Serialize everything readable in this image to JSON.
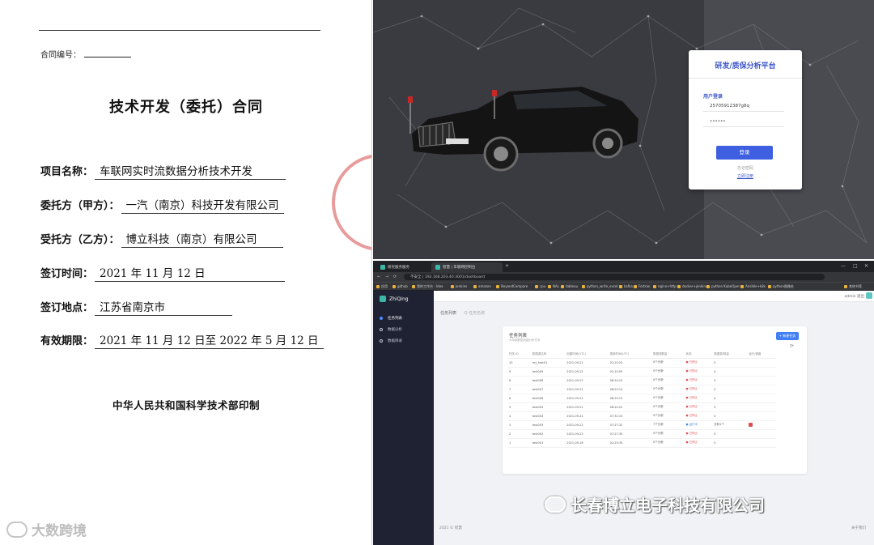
{
  "contract": {
    "contract_no_label": "合同编号：",
    "title": "技术开发（委托）合同",
    "fields": [
      {
        "label": "项目名称：",
        "value": "车联网实时流数据分析技术开发"
      },
      {
        "label": "委托方（甲方）：",
        "value": "一汽（南京）科技开发有限公司"
      },
      {
        "label": "受托方（乙方）：",
        "value": "博立科技（南京）有限公司"
      },
      {
        "label": "签订时间：",
        "value": "2021 年 11 月 12 日"
      },
      {
        "label": "签订地点：",
        "value": "江苏省南京市"
      },
      {
        "label": "有效期限：",
        "value": "2021 年 11 月 12 日至 2022 年 5 月 12 日"
      }
    ],
    "printed_by": "中华人民共和国科学技术部印制",
    "brand": "大数跨境"
  },
  "login": {
    "platform_title": "研发/质保分析平台",
    "subtitle": "用户登录",
    "username_value": "25705912387g8q",
    "password_value": "••••••",
    "login_button": "登录",
    "forgot_password": "忘记密码",
    "register_link": "立即注册"
  },
  "browser": {
    "tabs": [
      "研究服务服务",
      "智慧 | 车联网控制台"
    ],
    "new_tab": "+",
    "window_controls": [
      "—",
      "□",
      "✕"
    ],
    "nav": [
      "←",
      "→",
      "⟳"
    ],
    "url": "不安全 | 192.168.203.40:3001/dashboard",
    "bookmarks": [
      "应用",
      "github",
      "我的工作台 - Idea",
      "Jenkins",
      "amazon",
      "BeyondCompare",
      "cpu",
      "NAL",
      "tableau",
      "python_write_excel",
      "kafka",
      "Fortran",
      "nginx+http",
      "docker+jenkins",
      "python KubeOper",
      "Ansible+k8s",
      "python图像处",
      "其他书签"
    ]
  },
  "dashboard": {
    "brand": "ZhiQing",
    "side_items": [
      "任务列表",
      "数据分析",
      "数据目录"
    ],
    "user": "admin 退出",
    "breadcrumb": "任务列表",
    "search_hint": "Q 任务名称",
    "panel_title": "任务列表",
    "panel_subtitle": "为车辆数据创建分析任务",
    "create_button": "+ 新建任务",
    "refresh_icon": "refresh-icon",
    "columns": [
      "任务 ID",
      "数据源名称",
      "创建时间(UTC)",
      "更新时间(UTC)",
      "数据源数量",
      "状态",
      "数据源/数量",
      "运行/调度"
    ],
    "rows": [
      {
        "id": "10",
        "name": "my_test01",
        "created": "2021-09-21",
        "updated": "01:20:20",
        "sources": "0个分析",
        "status": "● 已停止",
        "count": "0",
        "op": ""
      },
      {
        "id": "9",
        "name": "test009",
        "created": "2021-09-22",
        "updated": "01:10:09",
        "sources": "0个分析",
        "status": "● 已停止",
        "count": "0",
        "op": ""
      },
      {
        "id": "8",
        "name": "test008",
        "created": "2021-09-22",
        "updated": "08:20:15",
        "sources": "0个分析",
        "status": "● 已停止",
        "count": "0",
        "op": ""
      },
      {
        "id": "7",
        "name": "test007",
        "created": "2021-09-22",
        "updated": "08:20:14",
        "sources": "0个分析",
        "status": "● 已停止",
        "count": "0",
        "op": ""
      },
      {
        "id": "6",
        "name": "test006",
        "created": "2021-09-22",
        "updated": "08:20:13",
        "sources": "0个分析",
        "status": "● 已停止",
        "count": "0",
        "op": ""
      },
      {
        "id": "5",
        "name": "test005",
        "created": "2021-09-22",
        "updated": "08:20:22",
        "sources": "0个分析",
        "status": "● 已停止",
        "count": "0",
        "op": ""
      },
      {
        "id": "4",
        "name": "test004",
        "created": "2021-09-22",
        "updated": "07:32:10",
        "sources": "0个分析",
        "status": "● 已停止",
        "count": "0",
        "op": ""
      },
      {
        "id": "3",
        "name": "test003",
        "created": "2021-09-22",
        "updated": "07:27:32",
        "sources": "7个分析",
        "status": "● 运行中",
        "count": "分析1个",
        "op": "delete"
      },
      {
        "id": "2",
        "name": "test002",
        "created": "2021-09-22",
        "updated": "07:27:30",
        "sources": "0个分析",
        "status": "● 已停止",
        "count": "0",
        "op": ""
      },
      {
        "id": "1",
        "name": "test001",
        "created": "2021-09-16",
        "updated": "02:25:35",
        "sources": "0个分析",
        "status": "● 已停止",
        "count": "0",
        "op": ""
      }
    ],
    "footer_left": "2021 © 智慧",
    "footer_right": "关于我们"
  },
  "watermark": "长春博立电子科技有限公司"
}
